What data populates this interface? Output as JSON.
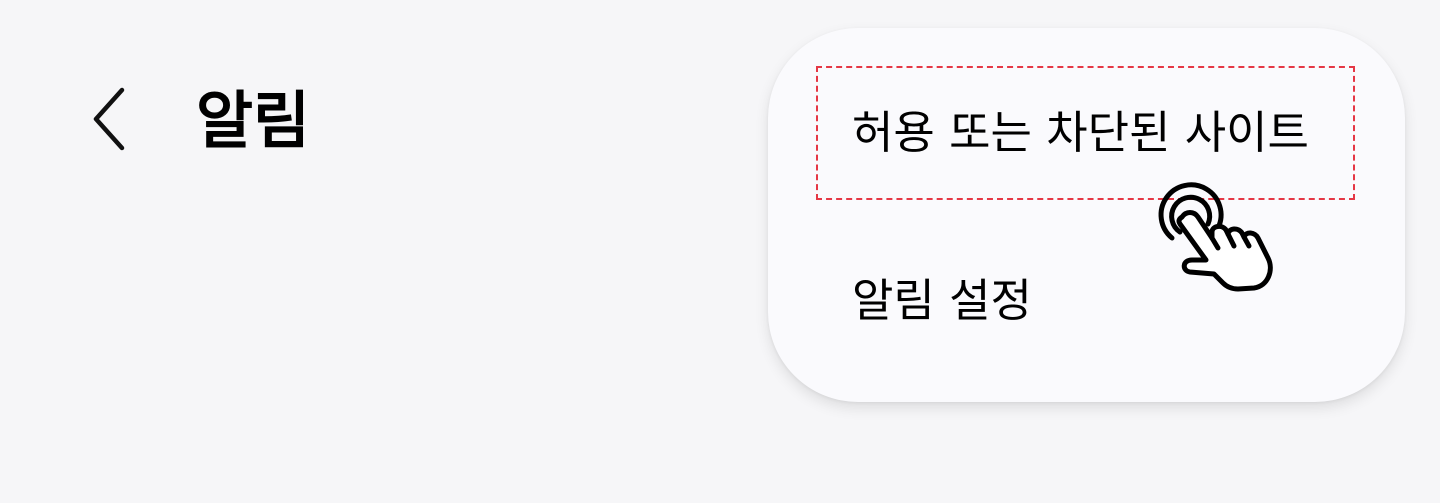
{
  "header": {
    "title": "알림",
    "back_icon": "chevron-left-icon"
  },
  "menu": {
    "items": [
      {
        "label": "허용 또는 차단된 사이트",
        "highlighted": true
      },
      {
        "label": "알림 설정",
        "highlighted": false
      }
    ]
  },
  "annotation": {
    "highlight_color": "#e53745",
    "pointer_icon": "tap-hand-icon"
  }
}
